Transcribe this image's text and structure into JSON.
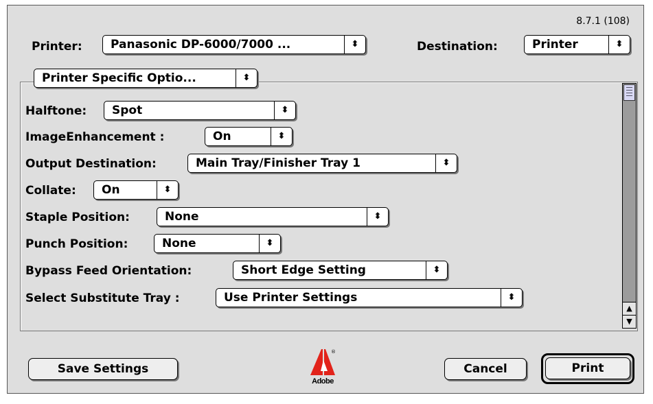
{
  "version": "8.7.1 (108)",
  "printer": {
    "label": "Printer:",
    "value": "Panasonic DP-6000/7000 ..."
  },
  "destination": {
    "label": "Destination:",
    "value": "Printer"
  },
  "panel_select": {
    "value": "Printer Specific Optio..."
  },
  "options": [
    {
      "label": "Halftone:",
      "value": "Spot"
    },
    {
      "label": "ImageEnhancement :",
      "value": "On"
    },
    {
      "label": "Output Destination:",
      "value": "Main Tray/Finisher Tray 1"
    },
    {
      "label": "Collate:",
      "value": "On"
    },
    {
      "label": "Staple Position:",
      "value": "None"
    },
    {
      "label": "Punch Position:",
      "value": "None"
    },
    {
      "label": "Bypass Feed Orientation:",
      "value": "Short Edge Setting"
    },
    {
      "label": "Select Substitute Tray :",
      "value": "Use Printer Settings"
    }
  ],
  "buttons": {
    "save": "Save Settings",
    "cancel": "Cancel",
    "print": "Print"
  },
  "logo": {
    "text": "Adobe",
    "mark": "®"
  },
  "icons": {
    "popup_arrow": "⬍"
  },
  "colors": {
    "window_bg": "#dedede",
    "scroll_track": "#9c9c9c",
    "thumb": "#d8d8f4",
    "logo_red": "#e2231a"
  }
}
